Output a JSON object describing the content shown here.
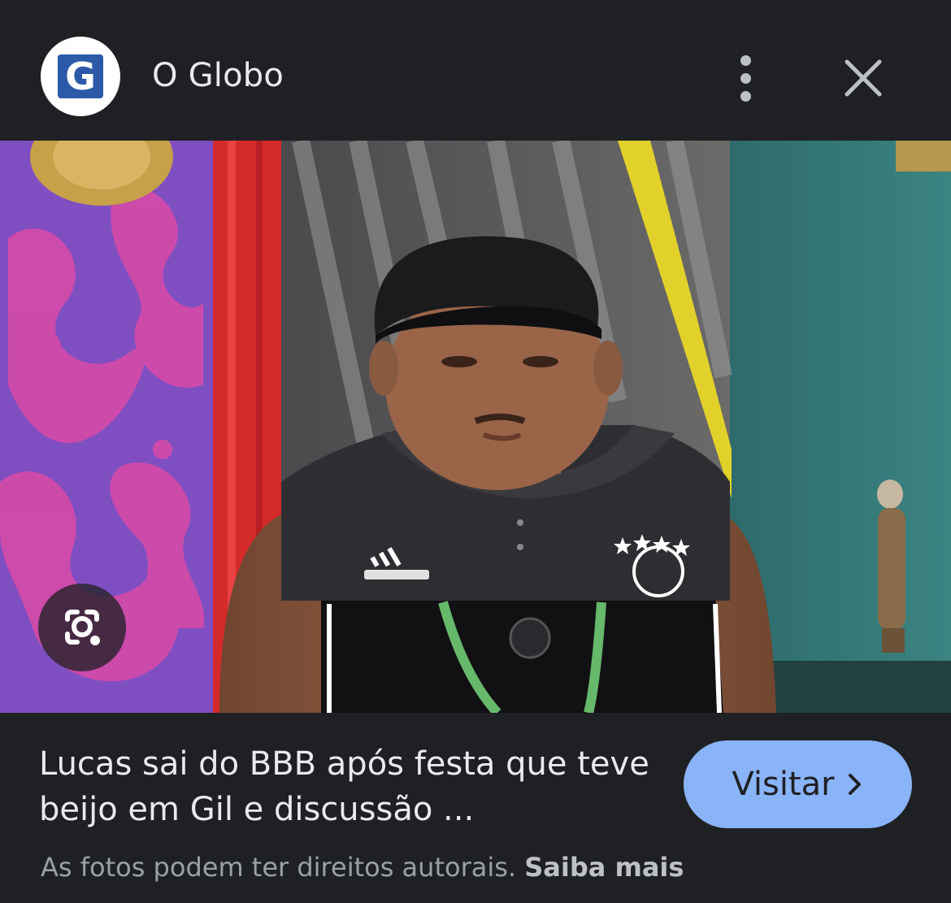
{
  "header": {
    "source_logo_letter": "G",
    "source_name": "O Globo",
    "more_icon": "more-vert-icon",
    "close_icon": "close-icon"
  },
  "image": {
    "lens_icon": "google-lens-icon"
  },
  "caption": {
    "title": "Lucas sai do BBB após festa que teve beijo em Gil e discussão ..."
  },
  "visit_button": {
    "label": "Visitar"
  },
  "footer": {
    "copyright_text": "As fotos podem ter direitos autorais.",
    "learn_more": "Saiba mais"
  },
  "colors": {
    "background": "#1f2023",
    "visit_button": "#8ab4f8",
    "logo_blue": "#2c5aa8"
  }
}
